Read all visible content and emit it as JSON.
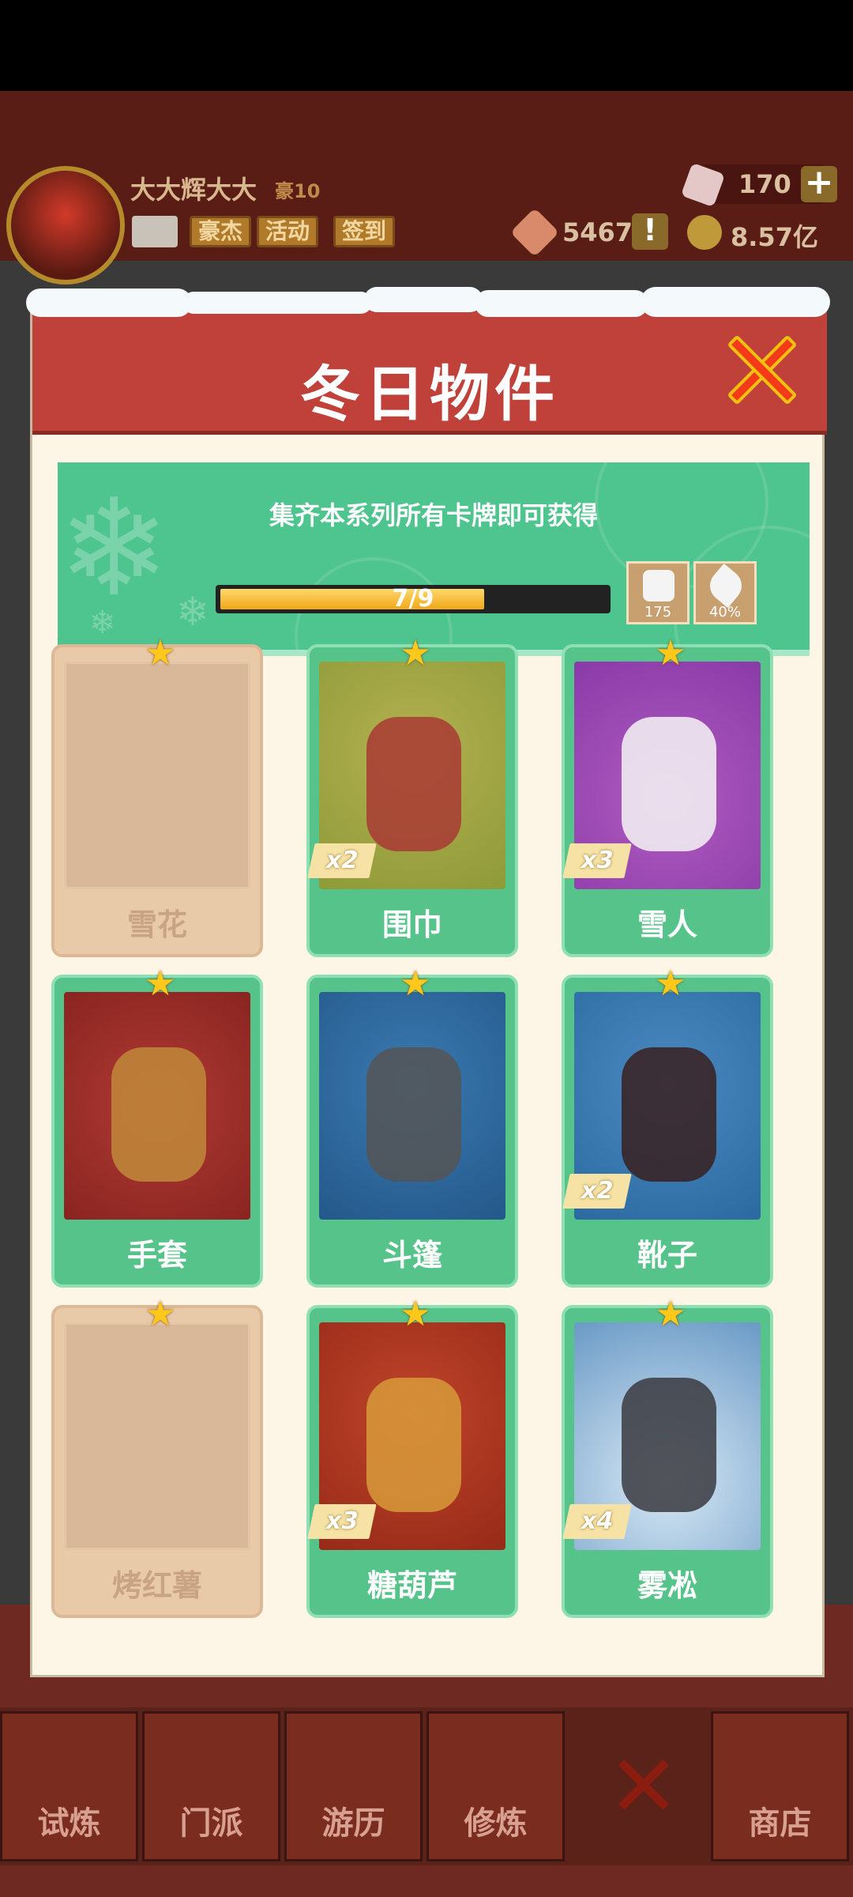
{
  "player": {
    "name": "大大辉大大",
    "rank": "豪10",
    "buttons": [
      "豪杰",
      "活动",
      "签到"
    ]
  },
  "resources": {
    "gems": "170",
    "tokens": "5467",
    "coins": "8.57亿"
  },
  "dialog": {
    "title": "冬日物件",
    "banner_text": "集齐本系列所有卡牌即可获得",
    "progress": {
      "text": "7/9",
      "value": 0.778
    },
    "rewards": [
      {
        "icon": "dice-icon",
        "label": "175"
      },
      {
        "icon": "blade-icon",
        "label": "40%"
      }
    ],
    "cards": [
      {
        "name": "雪花",
        "owned": false,
        "count": "",
        "art": "snowflake"
      },
      {
        "name": "围巾",
        "owned": true,
        "count": "x2",
        "art": "scarf"
      },
      {
        "name": "雪人",
        "owned": true,
        "count": "x3",
        "art": "snowman"
      },
      {
        "name": "手套",
        "owned": true,
        "count": "",
        "art": "gloves"
      },
      {
        "name": "斗篷",
        "owned": true,
        "count": "",
        "art": "cloak"
      },
      {
        "name": "靴子",
        "owned": true,
        "count": "x2",
        "art": "boots"
      },
      {
        "name": "烤红薯",
        "owned": false,
        "count": "",
        "art": "sweet-potato"
      },
      {
        "name": "糖葫芦",
        "owned": true,
        "count": "x3",
        "art": "candied-haws"
      },
      {
        "name": "雾凇",
        "owned": true,
        "count": "x4",
        "art": "rime"
      }
    ]
  },
  "bottom_nav": [
    "试炼",
    "门派",
    "游历",
    "修炼",
    "商店"
  ],
  "colors": {
    "header_red": "#c0403a",
    "banner_green": "#4ec48e",
    "card_green": "#56c48a",
    "locked_tan": "#e8c9a8"
  }
}
